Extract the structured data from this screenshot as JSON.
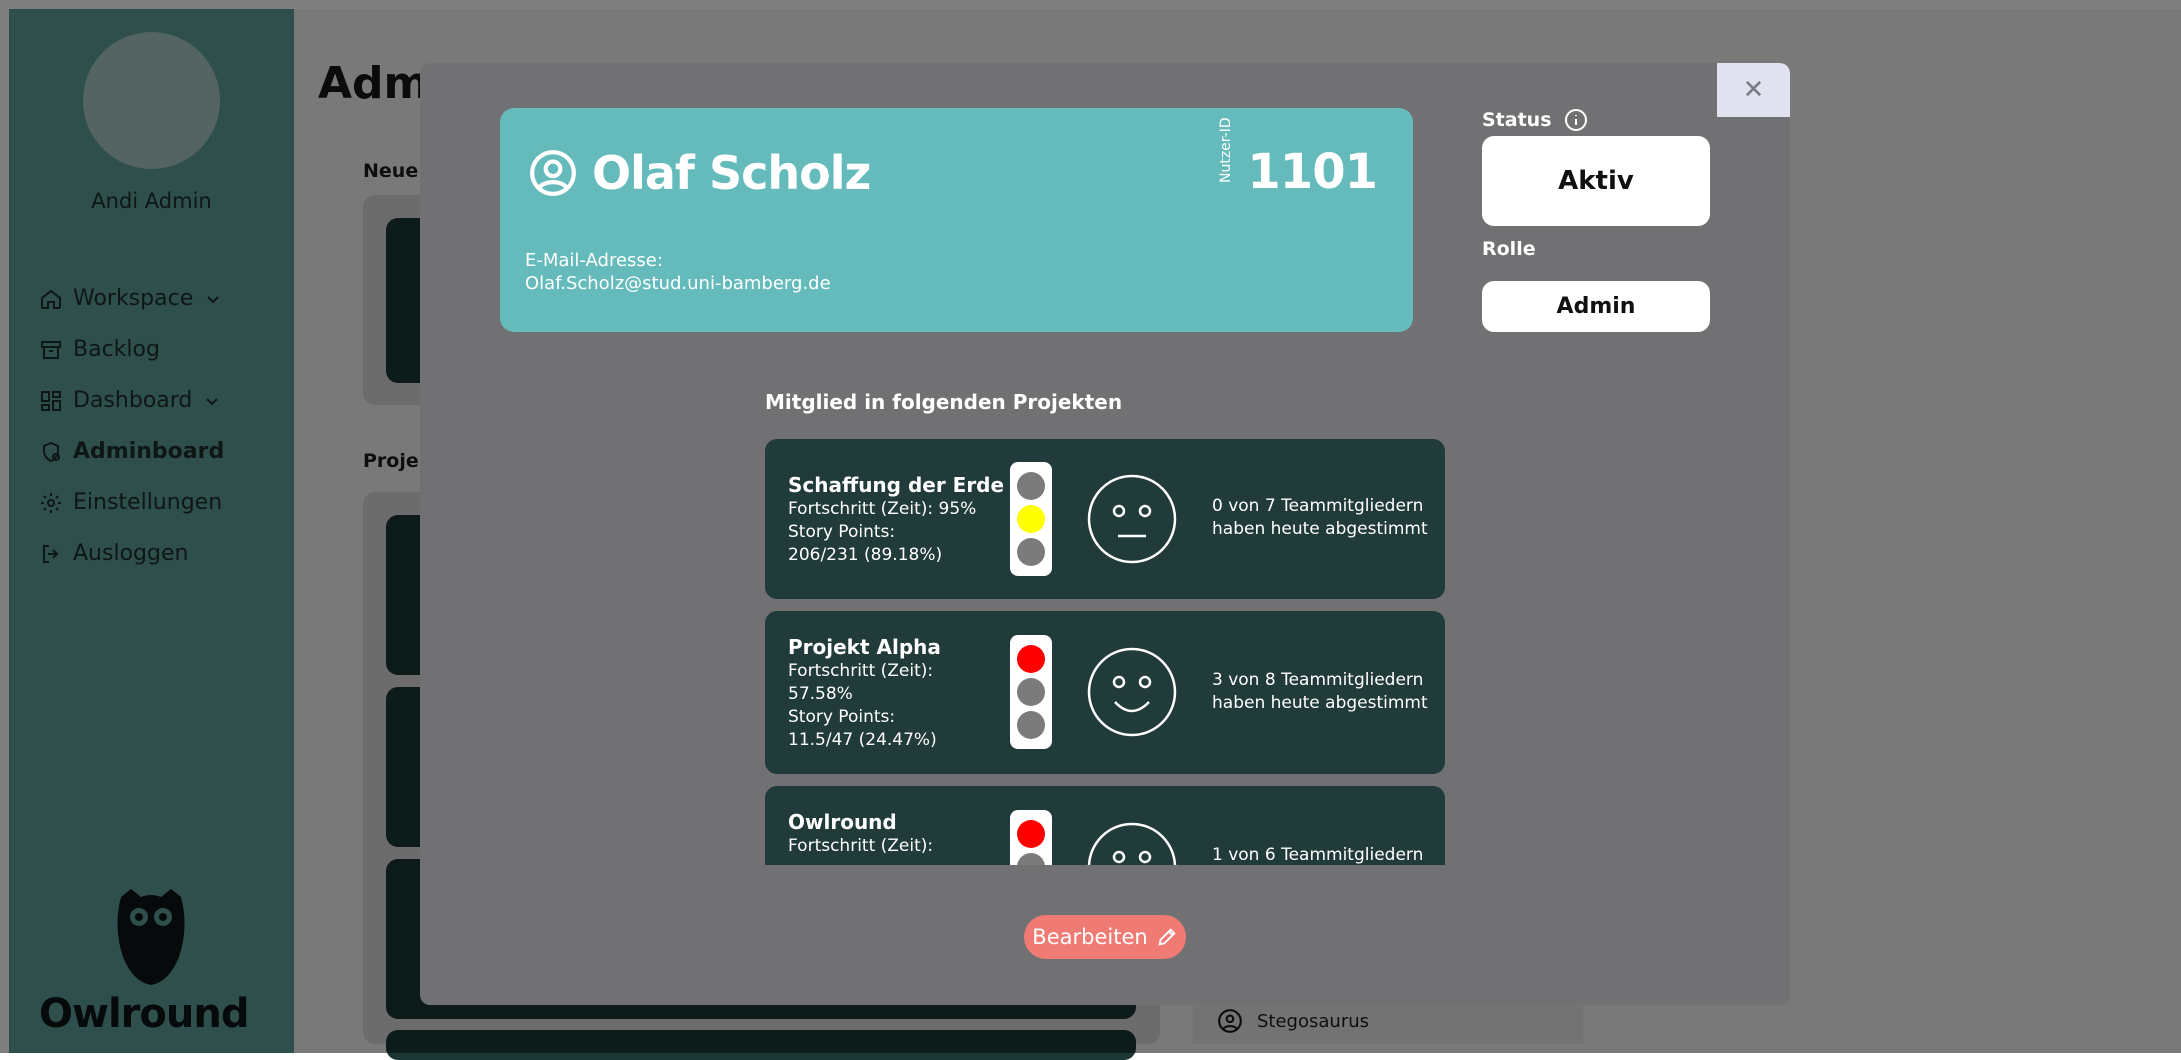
{
  "sidebar": {
    "user_name": "Andi Admin",
    "items": [
      {
        "label": "Workspace",
        "icon": "home-icon",
        "chevron": true
      },
      {
        "label": "Backlog",
        "icon": "archive-icon",
        "chevron": false
      },
      {
        "label": "Dashboard",
        "icon": "dashboard-icon",
        "chevron": true
      },
      {
        "label": "Adminboard",
        "icon": "admin-icon",
        "chevron": false,
        "active": true
      },
      {
        "label": "Einstellungen",
        "icon": "gear-icon",
        "chevron": false
      },
      {
        "label": "Ausloggen",
        "icon": "logout-icon",
        "chevron": false
      }
    ],
    "logo_text": "Owlround"
  },
  "background": {
    "title": "Admi",
    "section_new": "Neue I",
    "section_projects": "Projek",
    "list_item": "Stegosaurus"
  },
  "modal": {
    "close_symbol": "✕",
    "user": {
      "name": "Olaf Scholz",
      "id_label": "Nutzer-ID",
      "id": "1101",
      "email_label": "E-Mail-Adresse:",
      "email": "Olaf.Scholz@stud.uni-bamberg.de"
    },
    "status_label": "Status",
    "status_value": "Aktiv",
    "role_label": "Rolle",
    "role_value": "Admin",
    "projects_title": "Mitglied in folgenden Projekten",
    "projects": [
      {
        "name": "Schaffung der Erde",
        "lines": [
          "Fortschritt (Zeit): 95%",
          "Story Points:",
          "206/231 (89.18%)"
        ],
        "traffic_light": "yellow",
        "mood": "neutral",
        "votes": "0 von 7 Teammitgliedern haben heute abgestimmt"
      },
      {
        "name": "Projekt Alpha",
        "lines": [
          "Fortschritt (Zeit):",
          "57.58%",
          "Story Points:",
          "11.5/47 (24.47%)"
        ],
        "traffic_light": "red",
        "mood": "happy",
        "votes": "3 von 8 Teammitgliedern haben heute abgestimmt"
      },
      {
        "name": "Owlround",
        "lines": [
          "Fortschritt (Zeit):"
        ],
        "traffic_light": "red",
        "mood": "happy",
        "votes": "1 von 6 Teammitgliedern"
      }
    ],
    "edit_label": "Bearbeiten"
  },
  "colors": {
    "sidebar": "#5e9e9b",
    "user_card": "#65bbbb",
    "project_card": "#213a3a",
    "edit_button": "#f07a74",
    "light_red": "#ff0000",
    "light_yellow": "#ffff00",
    "light_off": "#7b7b7b"
  }
}
